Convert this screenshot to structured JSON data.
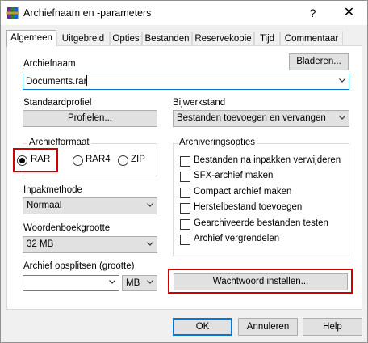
{
  "window": {
    "title": "Archiefnaam en -parameters",
    "help_glyph": "?",
    "close_glyph": "✕"
  },
  "tabs": [
    "Algemeen",
    "Uitgebreid",
    "Opties",
    "Bestanden",
    "Reservekopie",
    "Tijd",
    "Commentaar"
  ],
  "general": {
    "archive_name_label": "Archiefnaam",
    "browse_button": "Bladeren...",
    "archive_name_value": "Documents.rar",
    "default_profile_label": "Standaardprofiel",
    "profiles_button": "Profielen...",
    "update_mode_label": "Bijwerkstand",
    "update_mode_value": "Bestanden toevoegen en vervangen",
    "format_group_label": "Archiefformaat",
    "formats": [
      {
        "label": "RAR",
        "checked": true
      },
      {
        "label": "RAR4",
        "checked": false
      },
      {
        "label": "ZIP",
        "checked": false
      }
    ],
    "compression_label": "Inpakmethode",
    "compression_value": "Normaal",
    "dictionary_label": "Woordenboekgrootte",
    "dictionary_value": "32 MB",
    "split_label": "Archief opsplitsen (grootte)",
    "split_value": "",
    "split_unit": "MB",
    "options_group_label": "Archiveringsopties",
    "options": [
      "Bestanden na inpakken verwijderen",
      "SFX-archief maken",
      "Compact archief maken",
      "Herstelbestand toevoegen",
      "Gearchiveerde bestanden testen",
      "Archief vergrendelen"
    ],
    "password_button": "Wachtwoord instellen..."
  },
  "footer": {
    "ok": "OK",
    "cancel": "Annuleren",
    "help": "Help"
  },
  "colors": {
    "highlight": "#d00000",
    "accent": "#0078d7"
  }
}
